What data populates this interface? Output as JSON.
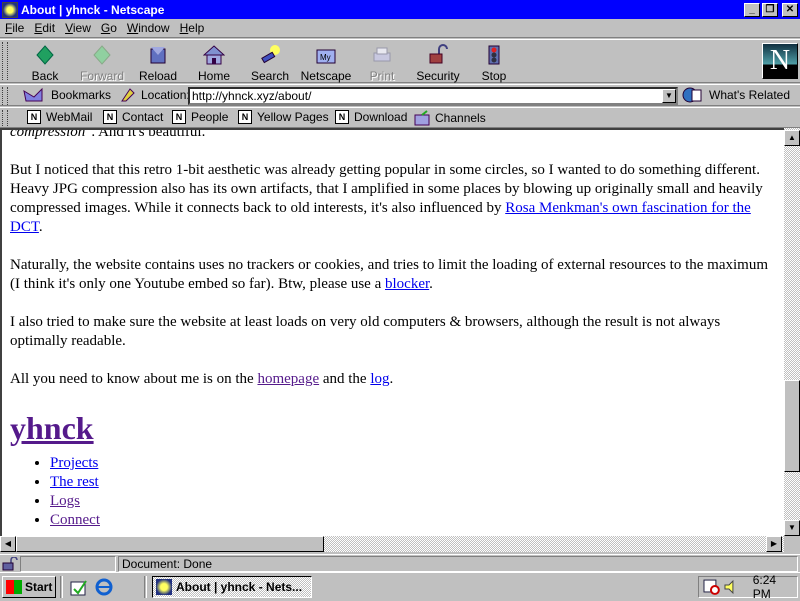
{
  "window": {
    "title": "About | yhnck - Netscape",
    "controls": {
      "minimize": "_",
      "restore": "❐",
      "close": "✕"
    }
  },
  "menu": [
    {
      "label": "File",
      "accel": "F",
      "rest": "ile"
    },
    {
      "label": "Edit",
      "accel": "E",
      "rest": "dit"
    },
    {
      "label": "View",
      "accel": "V",
      "rest": "iew"
    },
    {
      "label": "Go",
      "accel": "G",
      "rest": "o"
    },
    {
      "label": "Window",
      "accel": "W",
      "rest": "indow"
    },
    {
      "label": "Help",
      "accel": "H",
      "rest": "elp"
    }
  ],
  "navigation": [
    {
      "label": "Back",
      "icon": "back-arrow-icon",
      "enabled": true
    },
    {
      "label": "Forward",
      "icon": "forward-arrow-icon",
      "enabled": false
    },
    {
      "label": "Reload",
      "icon": "reload-icon",
      "enabled": true
    },
    {
      "label": "Home",
      "icon": "home-icon",
      "enabled": true
    },
    {
      "label": "Search",
      "icon": "search-icon",
      "enabled": true
    },
    {
      "label": "Netscape",
      "icon": "my-netscape-icon",
      "enabled": true
    },
    {
      "label": "Print",
      "icon": "print-icon",
      "enabled": false
    },
    {
      "label": "Security",
      "icon": "lock-icon",
      "enabled": true
    },
    {
      "label": "Stop",
      "icon": "stop-icon",
      "enabled": true
    }
  ],
  "logo": "N",
  "location": {
    "bookmarks_label": "Bookmarks",
    "location_label": "Location:",
    "url": "http://yhnck.xyz/about/",
    "whats_related": "What's Related"
  },
  "personal_toolbar": [
    "WebMail",
    "Contact",
    "People",
    "Yellow Pages",
    "Download",
    "Channels"
  ],
  "page": {
    "top_fragment_italic": "compression",
    "top_fragment_rest": "\". And it's beautiful.",
    "p1_text": "But I noticed that this retro 1-bit aesthetic was already getting popular in some circles, so I wanted to do something different. Heavy JPG compression also has its own artifacts, that I amplified in some places by blowing up originally small and heavily compressed images. While it connects back to old interests, it's also influenced by ",
    "p1_link": "Rosa Menkman's own fascination for the DCT",
    "p2_text": "Naturally, the website contains uses no trackers or cookies, and tries to limit the loading of external resources to the maximum (I think it's only one Youtube embed so far). Btw, please use a ",
    "p2_link": "blocker",
    "p3_text": "I also tried to make sure the website at least loads on very old computers & browsers, although the result is not always optimally readable.",
    "p4_text": "All you need to know about me is on the ",
    "p4_link1": "homepage",
    "p4_mid": " and the ",
    "p4_link2": "log",
    "period": ".",
    "heading": "yhnck",
    "nav_links": [
      {
        "label": "Projects",
        "visited": false
      },
      {
        "label": "The rest",
        "visited": false
      },
      {
        "label": "Logs",
        "visited": true
      },
      {
        "label": "Connect",
        "visited": true
      }
    ]
  },
  "status": {
    "text": "Document: Done"
  },
  "taskbar": {
    "start": "Start",
    "task": "About | yhnck - Nets...",
    "clock": "6:24 PM"
  },
  "colors": {
    "link": "#0000ee",
    "visited": "#551a8b",
    "titlebar": "#0000ff"
  }
}
